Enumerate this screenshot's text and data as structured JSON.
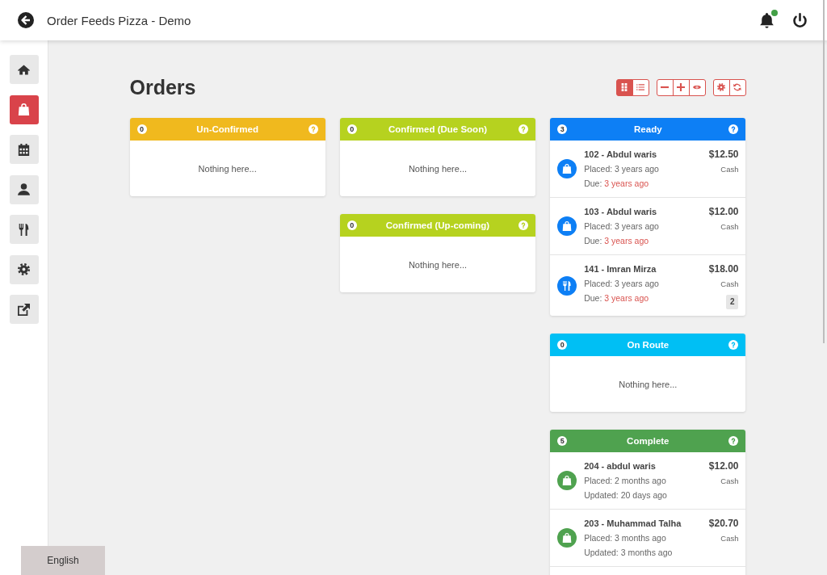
{
  "header": {
    "title": "Order Feeds Pizza - Demo",
    "notification_unread": true
  },
  "sidebar": {
    "items": [
      {
        "selected": false
      },
      {
        "selected": true
      },
      {
        "selected": false
      },
      {
        "selected": false
      },
      {
        "selected": false
      },
      {
        "selected": false
      },
      {
        "selected": false
      }
    ]
  },
  "page": {
    "title": "Orders"
  },
  "toolbar": {
    "groups": [
      {
        "buttons": [
          {
            "selected": true
          },
          {
            "selected": false
          }
        ]
      },
      {
        "buttons": [
          {
            "selected": false
          },
          {
            "selected": false
          },
          {
            "selected": false
          }
        ]
      },
      {
        "buttons": [
          {
            "selected": false
          },
          {
            "selected": false
          }
        ]
      }
    ]
  },
  "board": {
    "columns": [
      {
        "cards": [
          {
            "title": "Un-Confirmed",
            "count": "0",
            "color": "#f0b91e",
            "empty_text": "Nothing here..."
          }
        ]
      },
      {
        "cards": [
          {
            "title": "Confirmed (Due Soon)",
            "count": "0",
            "color": "#b6d21f",
            "empty_text": "Nothing here..."
          },
          {
            "title": "Confirmed (Up-coming)",
            "count": "0",
            "color": "#b6d21f",
            "empty_text": "Nothing here..."
          }
        ]
      },
      {
        "cards": [
          {
            "title": "Ready",
            "count": "3",
            "color": "#0d7ff5",
            "orders": [
              {
                "kind": "takeaway",
                "title": "102 - Abdul waris",
                "placed": "Placed: 3 years ago",
                "status_label": "Due:",
                "status_time": "3 years ago",
                "overdue": true,
                "price": "$12.50",
                "payment": "Cash"
              },
              {
                "kind": "takeaway",
                "title": "103 - Abdul waris",
                "placed": "Placed: 3 years ago",
                "status_label": "Due:",
                "status_time": "3 years ago",
                "overdue": true,
                "price": "$12.00",
                "payment": "Cash"
              },
              {
                "kind": "dinein",
                "title": "141 - Imran Mirza",
                "placed": "Placed: 3 years ago",
                "status_label": "Due:",
                "status_time": "3 years ago",
                "overdue": true,
                "price": "$18.00",
                "payment": "Cash",
                "badge": "2"
              }
            ]
          },
          {
            "title": "On Route",
            "count": "0",
            "color": "#00bff4",
            "empty_text": "Nothing here..."
          },
          {
            "title": "Complete",
            "count": "5",
            "color": "#4fa24f",
            "continues": true,
            "orders": [
              {
                "kind": "takeaway",
                "title": "204 - abdul waris",
                "placed": "Placed: 2 months ago",
                "status_label": "Updated:",
                "status_time": "20 days ago",
                "overdue": false,
                "price": "$12.00",
                "payment": "Cash"
              },
              {
                "kind": "takeaway",
                "title": "203 - Muhammad Talha",
                "placed": "Placed: 3 months ago",
                "status_label": "Updated:",
                "status_time": "3 months ago",
                "overdue": false,
                "price": "$20.70",
                "payment": "Cash"
              }
            ]
          }
        ]
      }
    ]
  },
  "language": "English"
}
